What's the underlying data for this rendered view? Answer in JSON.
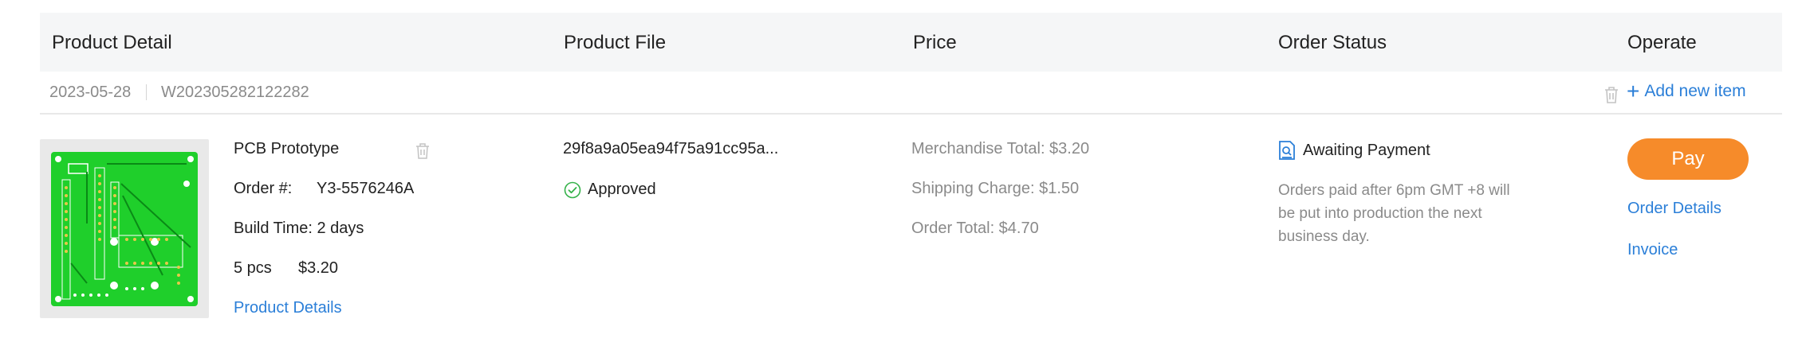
{
  "columns": {
    "product_detail": "Product Detail",
    "product_file": "Product File",
    "price": "Price",
    "order_status": "Order Status",
    "operate": "Operate"
  },
  "order": {
    "date": "2023-05-28",
    "order_no": "W202305282122282",
    "add_new_item": "Add new item"
  },
  "product": {
    "name": "PCB Prototype",
    "order_num_label": "Order #:",
    "order_num_value": "Y3-5576246A",
    "build_time": "Build Time: 2 days",
    "quantity": "5 pcs",
    "unit_price": "$3.20",
    "details_link": "Product Details"
  },
  "file": {
    "name": "29f8a9a05ea94f75a91cc95a...",
    "status": "Approved"
  },
  "price": {
    "merchandise_total": "Merchandise Total: $3.20",
    "shipping_charge": "Shipping Charge: $1.50",
    "order_total": "Order Total: $4.70"
  },
  "status": {
    "label": "Awaiting Payment",
    "note": "Orders paid after 6pm GMT +8 will be put into production the next business day."
  },
  "operate": {
    "pay": "Pay",
    "order_details": "Order Details",
    "invoice": "Invoice"
  },
  "colors": {
    "accent_blue": "#2b7fd8",
    "pay_orange": "#f68b2a",
    "approved_green": "#35b24a",
    "pcb_green": "#1fcf2b"
  },
  "icons": {
    "trash": "trash-icon",
    "add": "plus-icon",
    "approved": "check-circle-icon",
    "status": "document-search-icon"
  }
}
